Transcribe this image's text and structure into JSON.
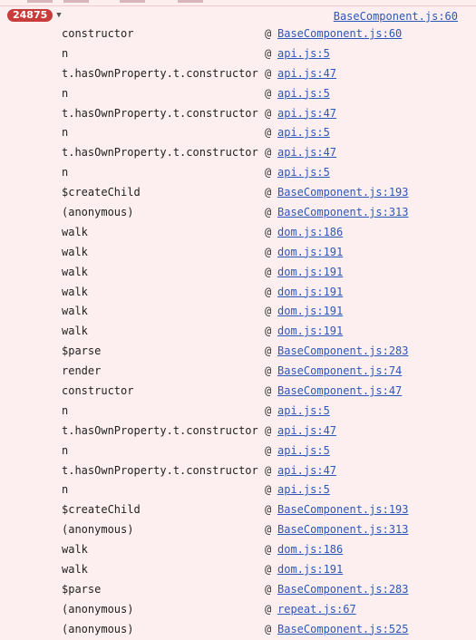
{
  "header": {
    "count_badge": "24875",
    "toggle_icon": "caret-down-icon",
    "source_link": "BaseComponent.js:60"
  },
  "frames": [
    {
      "fn": "constructor",
      "src": "BaseComponent.js:60"
    },
    {
      "fn": "n",
      "src": "api.js:5"
    },
    {
      "fn": "t.hasOwnProperty.t.constructor",
      "src": "api.js:47"
    },
    {
      "fn": "n",
      "src": "api.js:5"
    },
    {
      "fn": "t.hasOwnProperty.t.constructor",
      "src": "api.js:47"
    },
    {
      "fn": "n",
      "src": "api.js:5"
    },
    {
      "fn": "t.hasOwnProperty.t.constructor",
      "src": "api.js:47"
    },
    {
      "fn": "n",
      "src": "api.js:5"
    },
    {
      "fn": "$createChild",
      "src": "BaseComponent.js:193"
    },
    {
      "fn": "(anonymous)",
      "src": "BaseComponent.js:313"
    },
    {
      "fn": "walk",
      "src": "dom.js:186"
    },
    {
      "fn": "walk",
      "src": "dom.js:191"
    },
    {
      "fn": "walk",
      "src": "dom.js:191"
    },
    {
      "fn": "walk",
      "src": "dom.js:191"
    },
    {
      "fn": "walk",
      "src": "dom.js:191"
    },
    {
      "fn": "walk",
      "src": "dom.js:191"
    },
    {
      "fn": "$parse",
      "src": "BaseComponent.js:283"
    },
    {
      "fn": "render",
      "src": "BaseComponent.js:74"
    },
    {
      "fn": "constructor",
      "src": "BaseComponent.js:47"
    },
    {
      "fn": "n",
      "src": "api.js:5"
    },
    {
      "fn": "t.hasOwnProperty.t.constructor",
      "src": "api.js:47"
    },
    {
      "fn": "n",
      "src": "api.js:5"
    },
    {
      "fn": "t.hasOwnProperty.t.constructor",
      "src": "api.js:47"
    },
    {
      "fn": "n",
      "src": "api.js:5"
    },
    {
      "fn": "$createChild",
      "src": "BaseComponent.js:193"
    },
    {
      "fn": "(anonymous)",
      "src": "BaseComponent.js:313"
    },
    {
      "fn": "walk",
      "src": "dom.js:186"
    },
    {
      "fn": "walk",
      "src": "dom.js:191"
    },
    {
      "fn": "$parse",
      "src": "BaseComponent.js:283"
    },
    {
      "fn": "(anonymous)",
      "src": "repeat.js:67"
    },
    {
      "fn": "(anonymous)",
      "src": "BaseComponent.js:525"
    }
  ],
  "at_symbol": "@",
  "colors": {
    "background": "#fdeff0",
    "badge": "#c93c3c",
    "link": "#2d57b6"
  }
}
